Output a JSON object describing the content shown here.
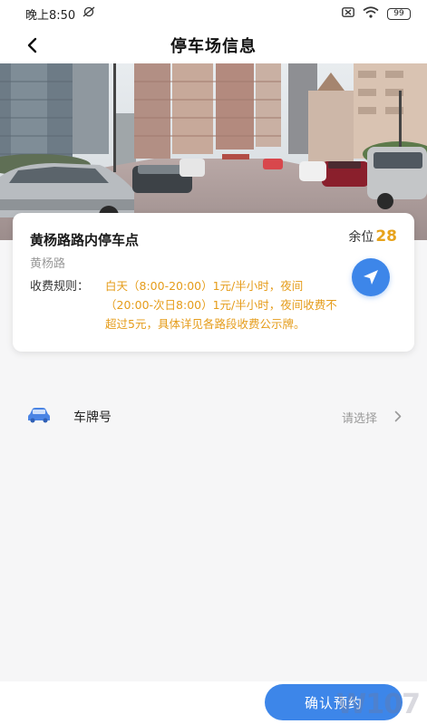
{
  "status_bar": {
    "time": "晚上8:50",
    "battery": "99"
  },
  "header": {
    "title": "停车场信息"
  },
  "lot": {
    "name": "黄杨路路内停车点",
    "remaining_label": "余位",
    "remaining_count": "28",
    "road": "黄杨路",
    "fee_label": "收费规则：",
    "fee_text": "白天（8:00-20:00）1元/半小时，夜间（20:00-次日8:00）1元/半小时，夜间收费不超过5元，具体详见各路段收费公示牌。"
  },
  "plate": {
    "label": "车牌号",
    "value": "请选择"
  },
  "footer": {
    "confirm_label": "确认预约"
  },
  "watermark": "W107",
  "colors": {
    "accent": "#3d86e9",
    "highlight": "#e7a31c"
  },
  "icons": [
    "back-arrow-icon",
    "navigation-arrow-icon",
    "car-icon",
    "chevron-right-icon",
    "wifi-icon",
    "battery-icon"
  ]
}
